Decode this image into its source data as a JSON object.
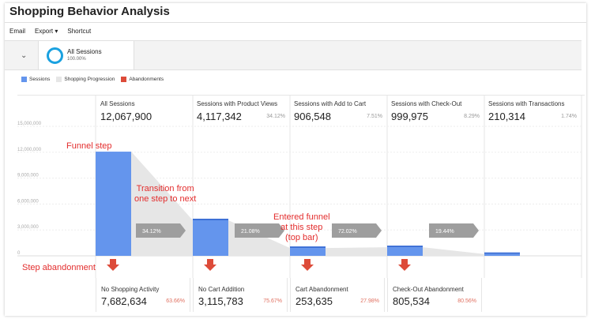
{
  "title": "Shopping Behavior Analysis",
  "toolbar": {
    "email": "Email",
    "export": "Export",
    "shortcut": "Shortcut"
  },
  "segment": {
    "name": "All Sessions",
    "pct": "100.00%"
  },
  "legend": [
    {
      "label": "Sessions",
      "color": "#6495ed"
    },
    {
      "label": "Shopping Progression",
      "color": "#e6e6e6"
    },
    {
      "label": "Abandonments",
      "color": "#dd4b39"
    }
  ],
  "columns": [
    {
      "label": "All Sessions",
      "value": "12,067,900",
      "pct": ""
    },
    {
      "label": "Sessions with Product Views",
      "value": "4,117,342",
      "pct": "34.12%"
    },
    {
      "label": "Sessions with Add to Cart",
      "value": "906,548",
      "pct": "7.51%"
    },
    {
      "label": "Sessions with Check-Out",
      "value": "999,975",
      "pct": "8.29%"
    },
    {
      "label": "Sessions with Transactions",
      "value": "210,314",
      "pct": "1.74%"
    }
  ],
  "abandonments": [
    {
      "label": "No Shopping Activity",
      "value": "7,682,634",
      "pct": "63.66%"
    },
    {
      "label": "No Cart Addition",
      "value": "3,115,783",
      "pct": "75.67%"
    },
    {
      "label": "Cart Abandonment",
      "value": "253,635",
      "pct": "27.98%"
    },
    {
      "label": "Check-Out Abandonment",
      "value": "805,534",
      "pct": "80.56%"
    }
  ],
  "transitions": [
    "34.12%",
    "21.08%",
    "72.02%",
    "19.44%"
  ],
  "annotations": {
    "funnel_step": "Funnel step",
    "transition": [
      "Transition from",
      "one step to next"
    ],
    "entered": [
      "Entered funnel",
      "at this step",
      "(top bar)"
    ],
    "step_abandonment": "Step abandonment"
  },
  "chart_data": {
    "type": "bar",
    "categories": [
      "All Sessions",
      "Sessions with Product Views",
      "Sessions with Add to Cart",
      "Sessions with Check-Out",
      "Sessions with Transactions"
    ],
    "values": [
      12067900,
      4117342,
      906548,
      999975,
      210314
    ],
    "entered": [
      12067900,
      4117342,
      906548,
      999975,
      210314
    ],
    "ylim": [
      0,
      15000000
    ],
    "yticks": [
      "15,000,000",
      "12,000,000",
      "9,000,000",
      "6,000,000",
      "3,000,000",
      "0"
    ],
    "ytick_values": [
      15000000,
      12000000,
      9000000,
      6000000,
      3000000,
      0
    ],
    "colors": {
      "sessions": "#6495ed",
      "progression": "#e6e6e6",
      "abandon": "#dd4b39",
      "transition": "#9e9e9e"
    }
  }
}
